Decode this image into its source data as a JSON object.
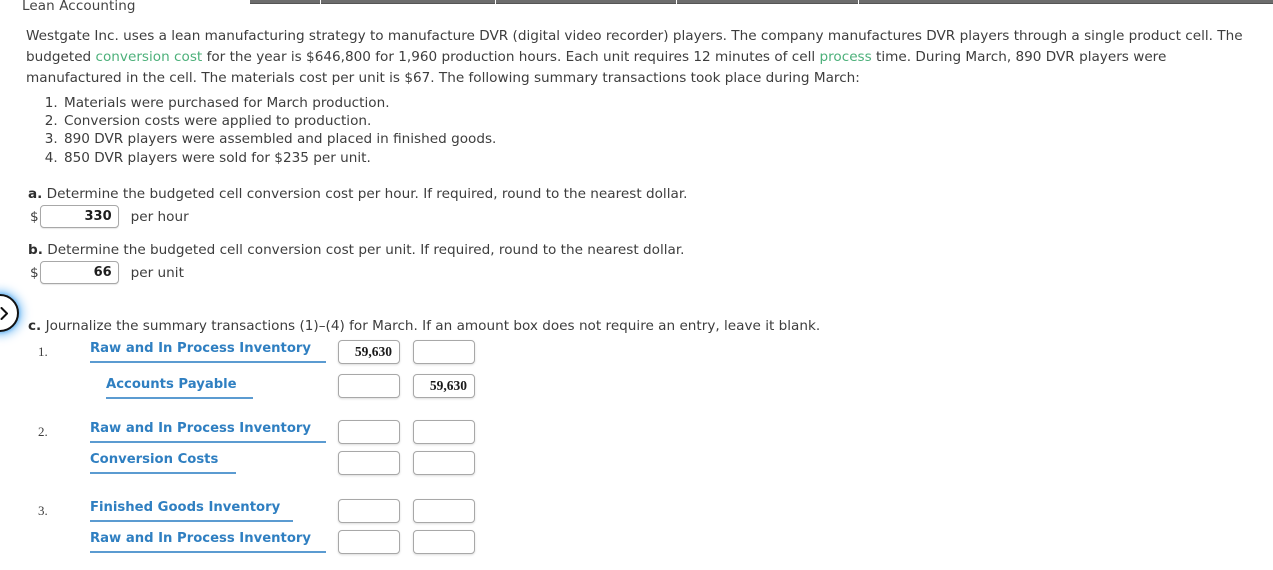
{
  "header": {
    "title": "Lean Accounting"
  },
  "topbar": {
    "segment_count": 5
  },
  "prose": {
    "part1": "Westgate Inc. uses a lean manufacturing strategy to manufacture DVR (digital video recorder) players. The company manufactures DVR players through a single product cell. The budgeted ",
    "link1": "conversion cost",
    "part2": " for the year is $646,800 for 1,960 production hours. Each unit requires 12 minutes of cell ",
    "link2": "process",
    "part3": " time. During March, 890 DVR players were manufactured in the cell. The materials cost per unit is $67. The following summary transactions took place during March:"
  },
  "transactions": [
    "Materials were purchased for March production.",
    "Conversion costs were applied to production.",
    "890 DVR players were assembled and placed in finished goods.",
    "850 DVR players were sold for $235 per unit."
  ],
  "parts": {
    "a": {
      "label": "a.",
      "text": "Determine the budgeted cell conversion cost per hour. If required, round to the nearest dollar.",
      "currency_symbol": "$",
      "value": "330",
      "unit": "per hour"
    },
    "b": {
      "label": "b.",
      "text": "Determine the budgeted cell conversion cost per unit. If required, round to the nearest dollar.",
      "currency_symbol": "$",
      "value": "66",
      "unit": "per unit"
    },
    "c": {
      "label": "c.",
      "text": "Journalize the summary transactions (1)–(4) for March. If an amount box does not require an entry, leave it blank."
    }
  },
  "journal": {
    "entries": [
      {
        "number": "1.",
        "lines": [
          {
            "account": "Raw and In Process Inventory",
            "indent": "indent0",
            "debit": "59,630",
            "credit": ""
          },
          {
            "account": "Accounts Payable",
            "indent": "indent1",
            "debit": "",
            "credit": "59,630"
          }
        ]
      },
      {
        "number": "2.",
        "lines": [
          {
            "account": "Raw and In Process Inventory",
            "indent": "indent0",
            "debit": "",
            "credit": ""
          },
          {
            "account": "Conversion Costs",
            "indent": "indent2",
            "debit": "",
            "credit": ""
          }
        ]
      },
      {
        "number": "3.",
        "lines": [
          {
            "account": "Finished Goods Inventory",
            "indent": "indent3",
            "debit": "",
            "credit": ""
          },
          {
            "account": "Raw and In Process Inventory",
            "indent": "indent0",
            "debit": "",
            "credit": ""
          }
        ]
      }
    ]
  },
  "nav": {
    "prev_label": "previous"
  },
  "colors": {
    "link_green": "#4cb07a",
    "account_blue": "#2f7fc1",
    "underline_blue": "#5b9bd1",
    "text": "#3d3d3d"
  }
}
